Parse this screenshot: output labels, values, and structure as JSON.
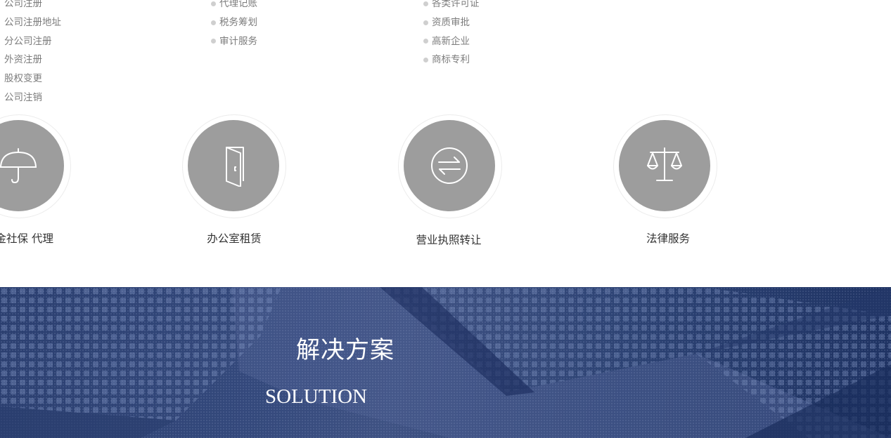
{
  "services_menu": {
    "columns": [
      {
        "items": [
          "公司注册",
          "公司注册地址",
          "分公司注册",
          "外资注册",
          "股权变更",
          "公司注销"
        ]
      },
      {
        "items": [
          "代理记账",
          "税务筹划",
          "审计服务"
        ]
      },
      {
        "items": [
          "各类许可证",
          "资质审批",
          "高新企业",
          "商标专利"
        ]
      },
      {
        "items": [
          ""
        ]
      }
    ]
  },
  "service_icons": [
    {
      "label": "积金社保 代理",
      "icon": "umbrella-icon"
    },
    {
      "label": "办公室租赁",
      "icon": "door-icon"
    },
    {
      "label": "营业执照转让",
      "icon": "exchange-arrows-icon"
    },
    {
      "label": "法律服务",
      "icon": "scales-icon"
    }
  ],
  "colors": {
    "icon_disc": "#9d9d9d",
    "menu_text": "#7d7d7d",
    "label_text": "#333333",
    "banner_bg": "#2c4273"
  },
  "solutions_banner": {
    "title": "解决方案",
    "subtitle": "SOLUTION"
  }
}
